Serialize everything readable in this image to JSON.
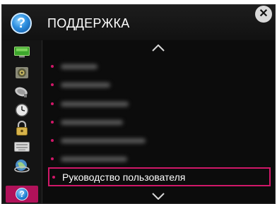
{
  "header": {
    "title": "ПОДДЕРЖКА",
    "help_symbol": "?",
    "close_symbol": "✕"
  },
  "sidebar": {
    "items": [
      {
        "icon": "screen-icon"
      },
      {
        "icon": "speaker-icon"
      },
      {
        "icon": "satellite-dish-icon"
      },
      {
        "icon": "clock-icon"
      },
      {
        "icon": "lock-icon"
      },
      {
        "icon": "keyboard-icon"
      },
      {
        "icon": "network-globe-icon"
      },
      {
        "icon": "help-icon",
        "active": true,
        "symbol": "?"
      }
    ]
  },
  "menu": {
    "items": [
      {
        "label": "",
        "blurred": true
      },
      {
        "label": "",
        "blurred": true
      },
      {
        "label": "",
        "blurred": true
      },
      {
        "label": "",
        "blurred": true
      },
      {
        "label": "",
        "blurred": true
      },
      {
        "label": "",
        "blurred": true
      },
      {
        "label": "Руководство пользователя",
        "focused": true
      }
    ]
  },
  "colors": {
    "accent": "#d01868",
    "background": "#0c0c0c",
    "active_sidebar": "#b0125a"
  }
}
